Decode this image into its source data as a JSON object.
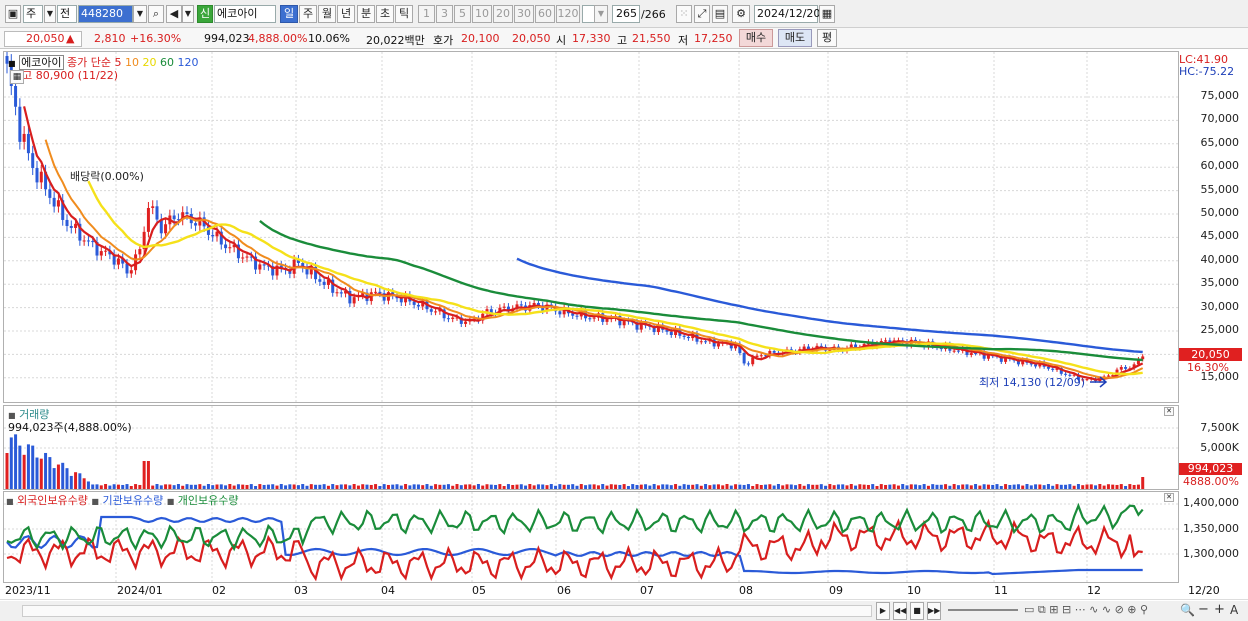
{
  "toolbar": {
    "market_select": "주",
    "period_select": "전",
    "stock_code": "448280",
    "new_badge": "신",
    "stock_name": "에코아이",
    "period_tabs": [
      "일",
      "주",
      "월",
      "년",
      "분",
      "초",
      "틱"
    ],
    "interval_buttons": [
      "1",
      "3",
      "5",
      "10",
      "20",
      "30",
      "60",
      "120"
    ],
    "count_field": "265",
    "count_total": "/266",
    "date_field": "2024/12/20"
  },
  "quote": {
    "price": "20,050",
    "change_arrow": "▲",
    "change": "2,810",
    "change_pct": "+16.30%",
    "volume": "994,023",
    "volume_ratio": "4,888.00%",
    "turnover": "10.06%",
    "amount": "20,022백만",
    "bid_label": "호가",
    "bid1": "20,100",
    "bid2": "20,050",
    "open_label": "시",
    "open": "17,330",
    "high_label": "고",
    "high": "21,550",
    "low_label": "저",
    "low": "17,250",
    "buy_button": "매수",
    "sell_button": "매도",
    "eval_button": "평"
  },
  "price_pane": {
    "stock_name": "에코아이",
    "ma_legend_prefix": "종가 단순",
    "ma_periods": [
      "5",
      "10",
      "20",
      "60",
      "120"
    ],
    "ma_colors": [
      "#d81e1e",
      "#f08c1e",
      "#e8d800",
      "#1a8c3a",
      "#2a5ad8"
    ],
    "high_note": "최고 80,900 (11/22)",
    "dividend_note": "배당락(0.00%)",
    "low_note": "최저 14,130 (12/09)",
    "lc_label": "LC:41.90",
    "hc_label": "HC:-75.22",
    "current_price_tag": "20,050",
    "current_pct_tag": "16.30%",
    "y_labels": [
      "75,000",
      "70,000",
      "65,000",
      "60,000",
      "55,000",
      "50,000",
      "45,000",
      "40,000",
      "35,000",
      "30,000",
      "25,000",
      "20,000",
      "15,000"
    ]
  },
  "volume_pane": {
    "title": "거래량",
    "value_note": "994,023주(4,888.00%)",
    "y_labels": [
      "7,500K",
      "5,000K"
    ],
    "current_tag": "994,023",
    "current_pct": "4888.00%"
  },
  "holdings_pane": {
    "legend": [
      "외국인보유수량",
      "기관보유수량",
      "개인보유수량"
    ],
    "legend_colors": [
      "#d81e1e",
      "#2a5ad8",
      "#1a8c3a"
    ],
    "y_labels": [
      "1,400,000",
      "1,350,000",
      "1,300,000"
    ]
  },
  "x_axis": {
    "labels": [
      "2023/11",
      "2024/01",
      "02",
      "03",
      "04",
      "05",
      "06",
      "07",
      "08",
      "09",
      "10",
      "11",
      "12"
    ],
    "last_date": "12/20"
  },
  "chart_data": {
    "type": "line",
    "series": [
      {
        "name": "5",
        "points": [
          [
            0,
            80900
          ],
          [
            6,
            62000
          ],
          [
            14,
            52000
          ],
          [
            22,
            45000
          ],
          [
            30,
            40000
          ],
          [
            36,
            38000
          ],
          [
            44,
            52000
          ],
          [
            50,
            48000
          ],
          [
            60,
            46000
          ],
          [
            75,
            40000
          ],
          [
            90,
            38000
          ],
          [
            110,
            34000
          ],
          [
            140,
            31000
          ],
          [
            160,
            27500
          ],
          [
            180,
            29500
          ],
          [
            200,
            30500
          ],
          [
            225,
            28000
          ],
          [
            260,
            26000
          ],
          [
            290,
            22500
          ],
          [
            310,
            19500
          ],
          [
            340,
            21000
          ],
          [
            360,
            21500
          ],
          [
            390,
            20000
          ],
          [
            410,
            18500
          ],
          [
            430,
            16500
          ],
          [
            440,
            15000
          ],
          [
            450,
            17000
          ],
          [
            458,
            20050
          ]
        ]
      },
      {
        "name": "120",
        "points": [
          [
            200,
            37500
          ],
          [
            240,
            34000
          ],
          [
            280,
            30500
          ],
          [
            320,
            27500
          ],
          [
            360,
            25000
          ],
          [
            400,
            23000
          ],
          [
            440,
            21500
          ],
          [
            458,
            21000
          ]
        ]
      }
    ],
    "ylim": [
      14000,
      82000
    ]
  }
}
